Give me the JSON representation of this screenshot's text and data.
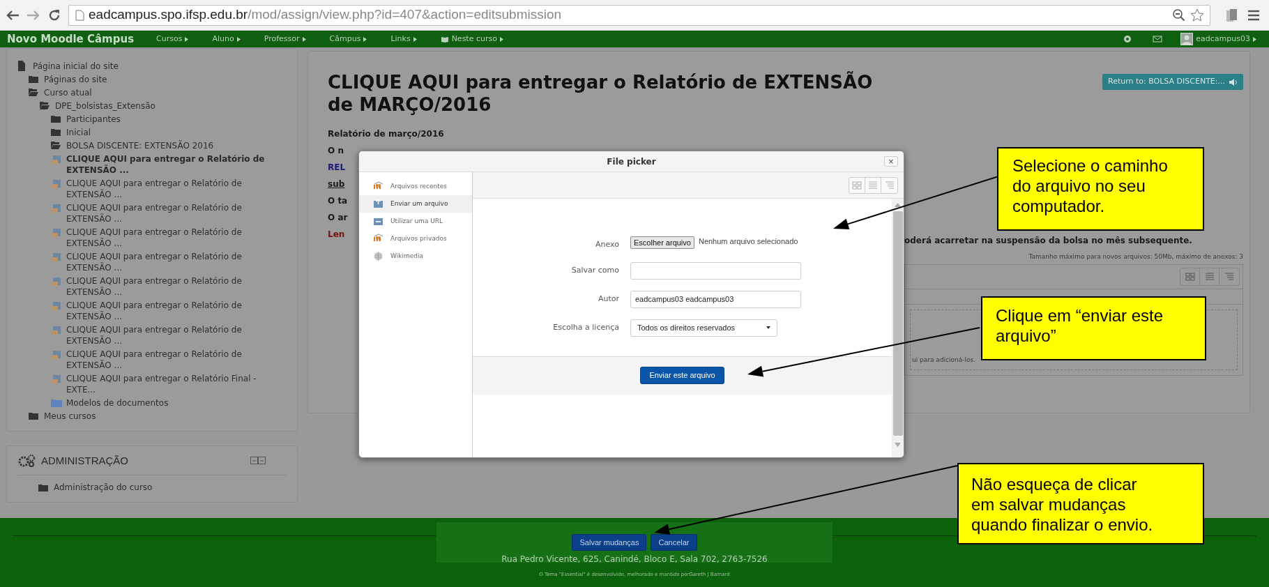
{
  "browser": {
    "url_host": "eadcampus.spo.ifsp.edu.br",
    "url_path": "/mod/assign/view.php?id=407&action=editsubmission"
  },
  "navbar": {
    "brand": "Novo Moodle Câmpus",
    "menus": [
      {
        "label": "Cursos",
        "kind": "plain"
      },
      {
        "label": "Aluno",
        "kind": "plain"
      },
      {
        "label": "Professor",
        "kind": "plain"
      },
      {
        "label": "Câmpus",
        "kind": "plain"
      },
      {
        "label": "Links",
        "kind": "plain"
      },
      {
        "label": "Neste curso",
        "kind": "book"
      }
    ],
    "user": "eadcampus03"
  },
  "sidebar": {
    "items": [
      {
        "label": "Página inicial do site",
        "kind": "page",
        "selected": false,
        "children": [
          {
            "label": "Páginas do site",
            "kind": "folder",
            "selected": false
          },
          {
            "label": "Curso atual",
            "kind": "folder-open",
            "selected": false,
            "children": [
              {
                "label": "DPE_bolsistas_Extensão",
                "kind": "folder-open",
                "selected": false,
                "children": [
                  {
                    "label": "Participantes",
                    "kind": "folder",
                    "selected": false
                  },
                  {
                    "label": "Inicial",
                    "kind": "folder",
                    "selected": false
                  },
                  {
                    "label": "BOLSA DISCENTE: EXTENSÃO 2016",
                    "kind": "folder-open",
                    "selected": false,
                    "children": [
                      {
                        "label": "CLIQUE AQUI para entregar o Relatório de EXTENSÃO ...",
                        "kind": "assignment",
                        "selected": true
                      },
                      {
                        "label": "CLIQUE AQUI para entregar o Relatório de EXTENSÃO ...",
                        "kind": "assignment",
                        "selected": false
                      },
                      {
                        "label": "CLIQUE AQUI para entregar o Relatório de EXTENSÃO ...",
                        "kind": "assignment",
                        "selected": false
                      },
                      {
                        "label": "CLIQUE AQUI para entregar o Relatório de EXTENSÃO ...",
                        "kind": "assignment",
                        "selected": false
                      },
                      {
                        "label": "CLIQUE AQUI para entregar o Relatório de EXTENSÃO ...",
                        "kind": "assignment",
                        "selected": false
                      },
                      {
                        "label": "CLIQUE AQUI para entregar o Relatório de EXTENSÃO ...",
                        "kind": "assignment",
                        "selected": false
                      },
                      {
                        "label": "CLIQUE AQUI para entregar o Relatório de EXTENSÃO ...",
                        "kind": "assignment",
                        "selected": false
                      },
                      {
                        "label": "CLIQUE AQUI para entregar o Relatório de EXTENSÃO ...",
                        "kind": "assignment",
                        "selected": false
                      },
                      {
                        "label": "CLIQUE AQUI para entregar o Relatório de EXTENSÃO ...",
                        "kind": "assignment",
                        "selected": false
                      },
                      {
                        "label": "CLIQUE AQUI para entregar o Relatório Final - EXTE...",
                        "kind": "assignment",
                        "selected": false
                      },
                      {
                        "label": "Modelos de documentos",
                        "kind": "resource-folder",
                        "selected": false
                      }
                    ]
                  }
                ]
              }
            ]
          },
          {
            "label": "Meus cursos",
            "kind": "folder",
            "selected": false
          }
        ]
      }
    ]
  },
  "admin": {
    "title": "ADMINISTRAÇÃO",
    "items": [
      {
        "label": "Administração do curso",
        "kind": "folder"
      }
    ]
  },
  "main": {
    "title": "CLIQUE AQUI para entregar o Relatório de EXTENSÃO de MARÇO/2016",
    "return_button": "Return to: BOLSA DISCENTE:...",
    "lines": [
      {
        "text": "Relatório de março/2016",
        "kind": "heading"
      },
      {
        "text": "O n",
        "kind": "text"
      },
      {
        "text": "REL",
        "kind": "link"
      },
      {
        "text": "sub",
        "kind": "underline"
      },
      {
        "text": "O ta",
        "kind": "text"
      },
      {
        "text": "O ar",
        "kind": "text"
      },
      {
        "text": "Len",
        "kind": "warning"
      }
    ],
    "line_tail": "oderá acarretar na suspensão da bolsa no mês subsequente.",
    "file_limits": "Tamanho máximo para novos arquivos: 50Mb, máximo de anexos: 3",
    "drop_hint": "ui para adicioná-los."
  },
  "file_picker": {
    "title": "File picker",
    "close": "×",
    "sources": [
      {
        "label": "Arquivos recentes",
        "kind": "moodle",
        "selected": false
      },
      {
        "label": "Enviar um arquivo",
        "kind": "upload",
        "selected": true
      },
      {
        "label": "Utilizar uma URL",
        "kind": "url",
        "selected": false
      },
      {
        "label": "Arquivos privados",
        "kind": "moodle",
        "selected": false
      },
      {
        "label": "Wikimedia",
        "kind": "wikimedia",
        "selected": false
      }
    ],
    "fields": [
      {
        "label": "Anexo",
        "kind": "file",
        "button": "Escolher arquivo",
        "value": "Nenhum arquivo selecionado"
      },
      {
        "label": "Salvar como",
        "kind": "text"
      },
      {
        "label": "Autor",
        "kind": "text",
        "value": "eadcampus03 eadcampus03"
      },
      {
        "label": "Escolha a licença",
        "kind": "select",
        "value": "Todos os direitos reservados"
      }
    ],
    "submit": "Enviar este arquivo"
  },
  "callouts": [
    {
      "text": "Selecione o caminho do arquivo no seu computador."
    },
    {
      "text": "Clique em “enviar este arquivo”"
    },
    {
      "text": "Não esqueça de clicar em salvar mudanças quando finalizar o envio."
    }
  ],
  "footer": {
    "buttons": [
      "Salvar mudanças",
      "Cancelar"
    ],
    "address": "Rua Pedro Vicente, 625, Canindé, Bloco E, Sala 702, 2763-7526",
    "credits": "O Tema \"Essential\" é desenvolvido, melhorado e mantido porGareth J Barnard"
  }
}
